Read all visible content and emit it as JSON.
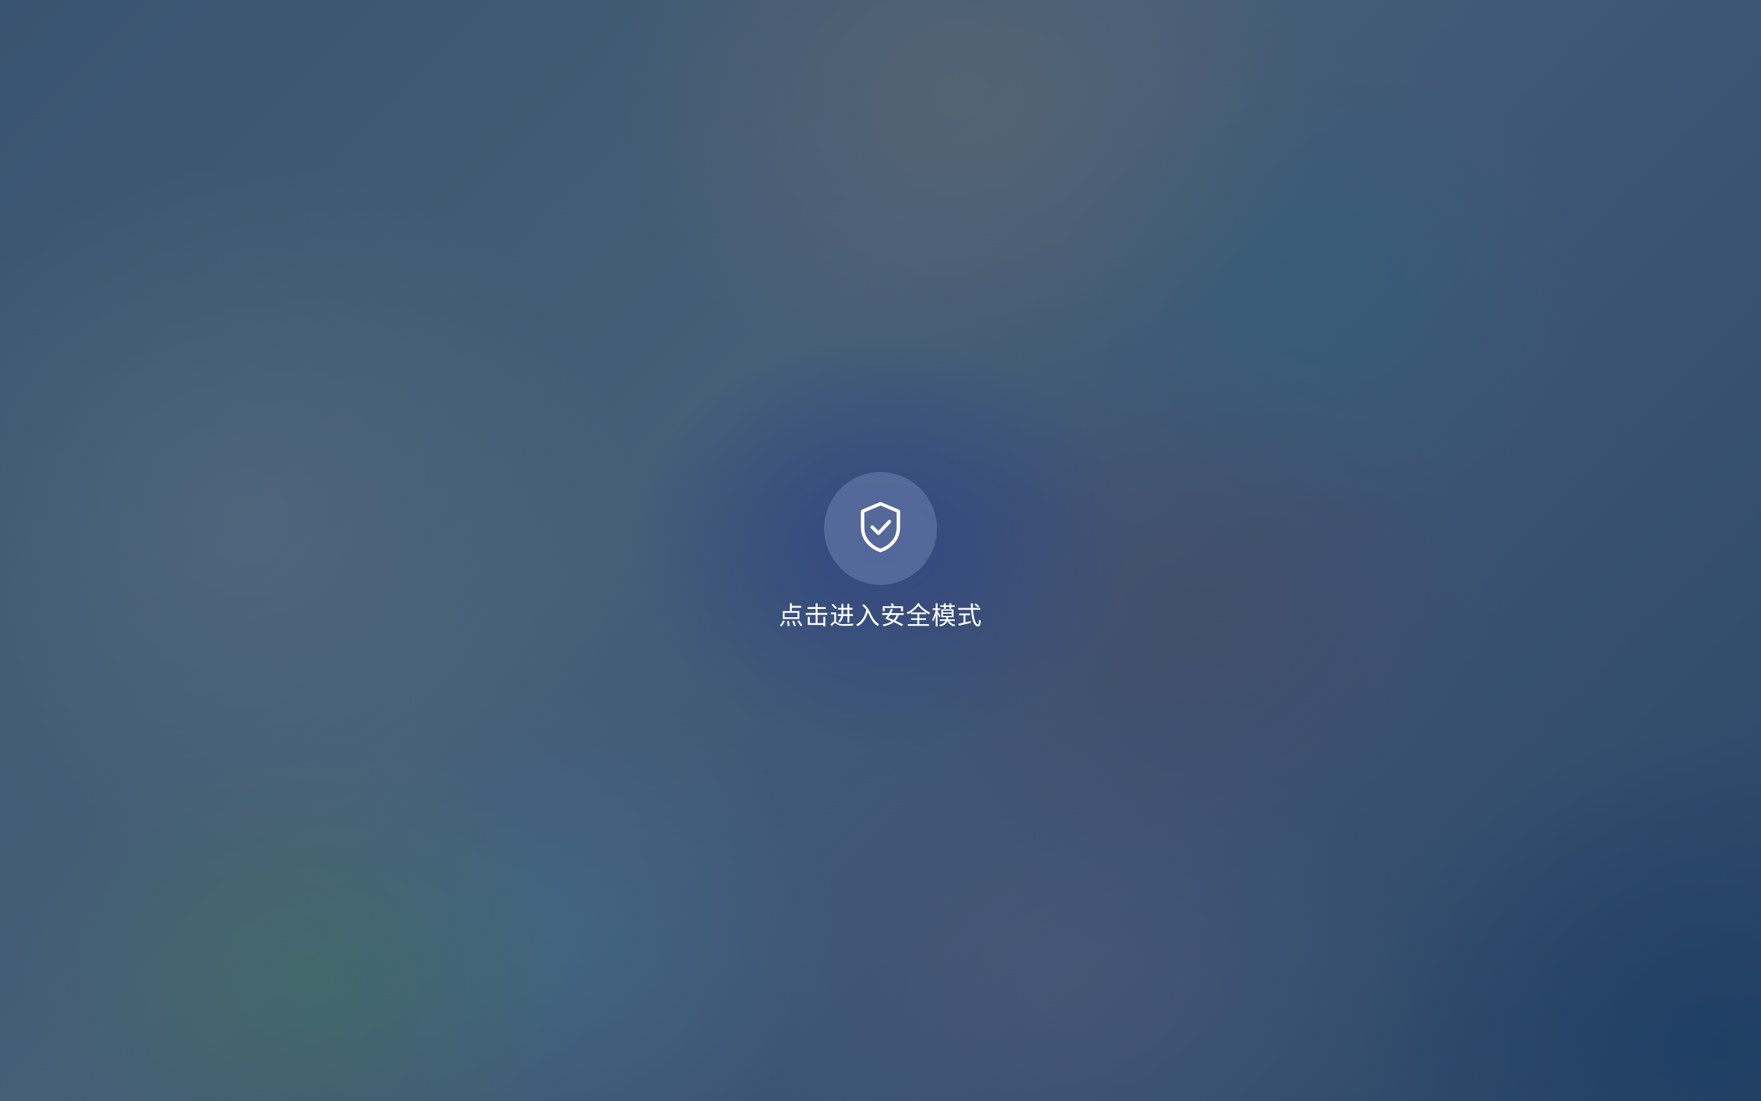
{
  "safe_mode": {
    "icon": "shield-check-icon",
    "label": "点击进入安全模式"
  },
  "colors": {
    "button_fill": "#6e82af",
    "label_text": "#ffffff"
  }
}
